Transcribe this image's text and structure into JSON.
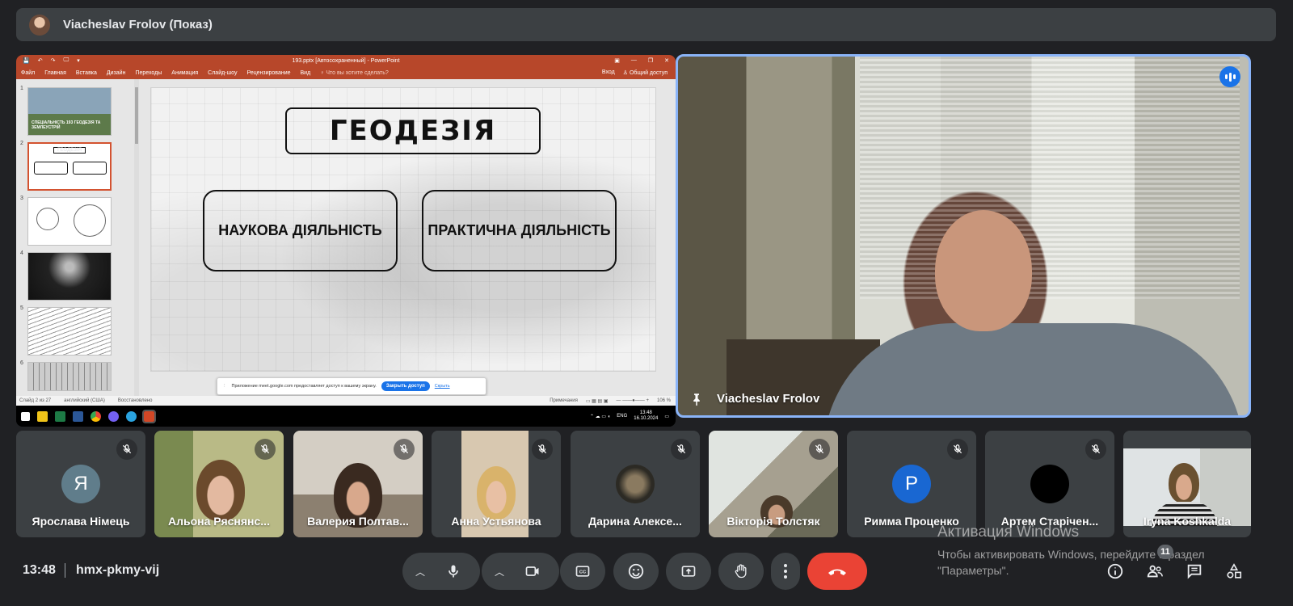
{
  "presenter_bar": {
    "title": "Viacheslav Frolov (Показ)"
  },
  "powerpoint": {
    "doc_title": "193.pptx [Автосохраненный] - PowerPoint",
    "quick_access": [
      "💾",
      "↶",
      "↷",
      "🖵",
      "▾"
    ],
    "window_controls": [
      "▣",
      "—",
      "❐",
      "✕"
    ],
    "ribbon_tabs": [
      "Файл",
      "Главная",
      "Вставка",
      "Дизайн",
      "Переходы",
      "Анимация",
      "Слайд-шоу",
      "Рецензирование",
      "Вид"
    ],
    "tell_me": "♀ Что вы хотите сделать?",
    "sign_in": "Вход",
    "share": "♙ Общий доступ",
    "thumb_numbers": [
      "1",
      "2",
      "3",
      "4",
      "5",
      "6"
    ],
    "thumb1_caption": "СПЕЦІАЛЬНІСТЬ 193 ГЕОДЕЗІЯ ТА ЗЕМЛЕУСТРІЙ",
    "thumb2_title": "ГЕОДЕЗІЯ",
    "slide": {
      "title": "ГЕОДЕЗІЯ",
      "box_left": "НАУКОВА ДІЯЛЬНІСТЬ",
      "box_right": "ПРАКТИЧНА ДІЯЛЬНІСТЬ"
    },
    "share_notice": {
      "text": "Приложение meet.google.com предоставляет доступ к вашему экрану.",
      "stop_button": "Закрыть доступ",
      "hide_link": "Скрыть"
    },
    "status": {
      "slide_of": "Слайд 2 из 27",
      "language": "английский (США)",
      "recovered": "Восстановлено",
      "notes": "Примечания",
      "zoom": "106 %"
    },
    "taskbar_clock": {
      "time": "13:48",
      "date": "16.10.2024"
    },
    "taskbar_lang": "ENG"
  },
  "speaker": {
    "name": "Viacheslav Frolov"
  },
  "participants": [
    {
      "name": "Ярослава Німець",
      "letter": "Я",
      "color": "#607d8b"
    },
    {
      "name": "Альона Ряснянс..."
    },
    {
      "name": "Валерия Полтав..."
    },
    {
      "name": "Анна Устьянова"
    },
    {
      "name": "Дарина Алексе..."
    },
    {
      "name": "Вікторія Толстяк"
    },
    {
      "name": "Римма Проценко",
      "letter": "Р",
      "color": "#1967d2"
    },
    {
      "name": "Артем Старічен..."
    },
    {
      "name": "Iryna Koshkalda"
    }
  ],
  "bottom_bar": {
    "time": "13:48",
    "meeting_code": "hmx-pkmy-vij",
    "participant_count": "11"
  },
  "watermark": {
    "title": "Активация Windows",
    "line1": "Чтобы активировать Windows, перейдите в раздел",
    "line2": "\"Параметры\"."
  }
}
